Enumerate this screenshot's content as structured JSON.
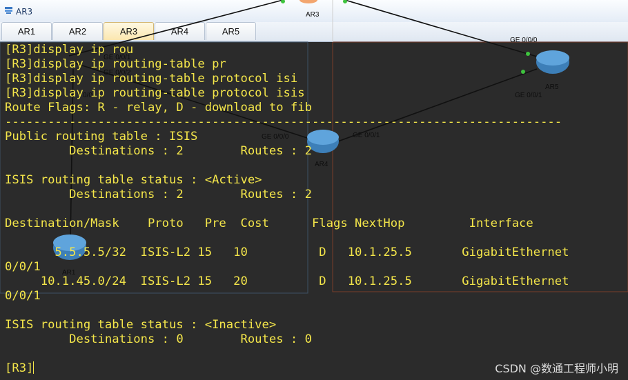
{
  "window": {
    "title": "AR3"
  },
  "tabs": [
    {
      "label": "AR1",
      "active": false
    },
    {
      "label": "AR2",
      "active": false
    },
    {
      "label": "AR3",
      "active": true
    },
    {
      "label": "AR4",
      "active": false
    },
    {
      "label": "AR5",
      "active": false
    }
  ],
  "topology": {
    "devices": [
      "AR3",
      "AR5",
      "AR4",
      "AR1"
    ],
    "ports": [
      "GE 0/0/1",
      "GE 0/0/2",
      "0/0",
      "GE 0/0/0",
      "GE 0/0/1",
      "GE 0/0/0",
      "GE 0/0/1"
    ]
  },
  "terminal": {
    "lines": [
      "[R3]display ip rou",
      "[R3]display ip routing-table pr",
      "[R3]display ip routing-table protocol isi",
      "[R3]display ip routing-table protocol isis",
      "Route Flags: R - relay, D - download to fib",
      "------------------------------------------------------------------------------",
      "Public routing table : ISIS",
      "         Destinations : 2        Routes : 2",
      "",
      "ISIS routing table status : <Active>",
      "         Destinations : 2        Routes : 2",
      "",
      "Destination/Mask    Proto   Pre  Cost      Flags NextHop         Interface",
      "",
      "       5.5.5.5/32  ISIS-L2 15   10          D   10.1.25.5       GigabitEthernet",
      "0/0/1",
      "     10.1.45.0/24  ISIS-L2 15   20          D   10.1.25.5       GigabitEthernet",
      "0/0/1",
      "",
      "ISIS routing table status : <Inactive>",
      "         Destinations : 0        Routes : 0",
      "",
      "[R3]"
    ]
  },
  "watermark": "CSDN @数通工程师小明",
  "colors": {
    "terminal_bg": "#2b2b2b",
    "terminal_text": "#f4e64a",
    "active_tab": "#fbe7b0"
  }
}
